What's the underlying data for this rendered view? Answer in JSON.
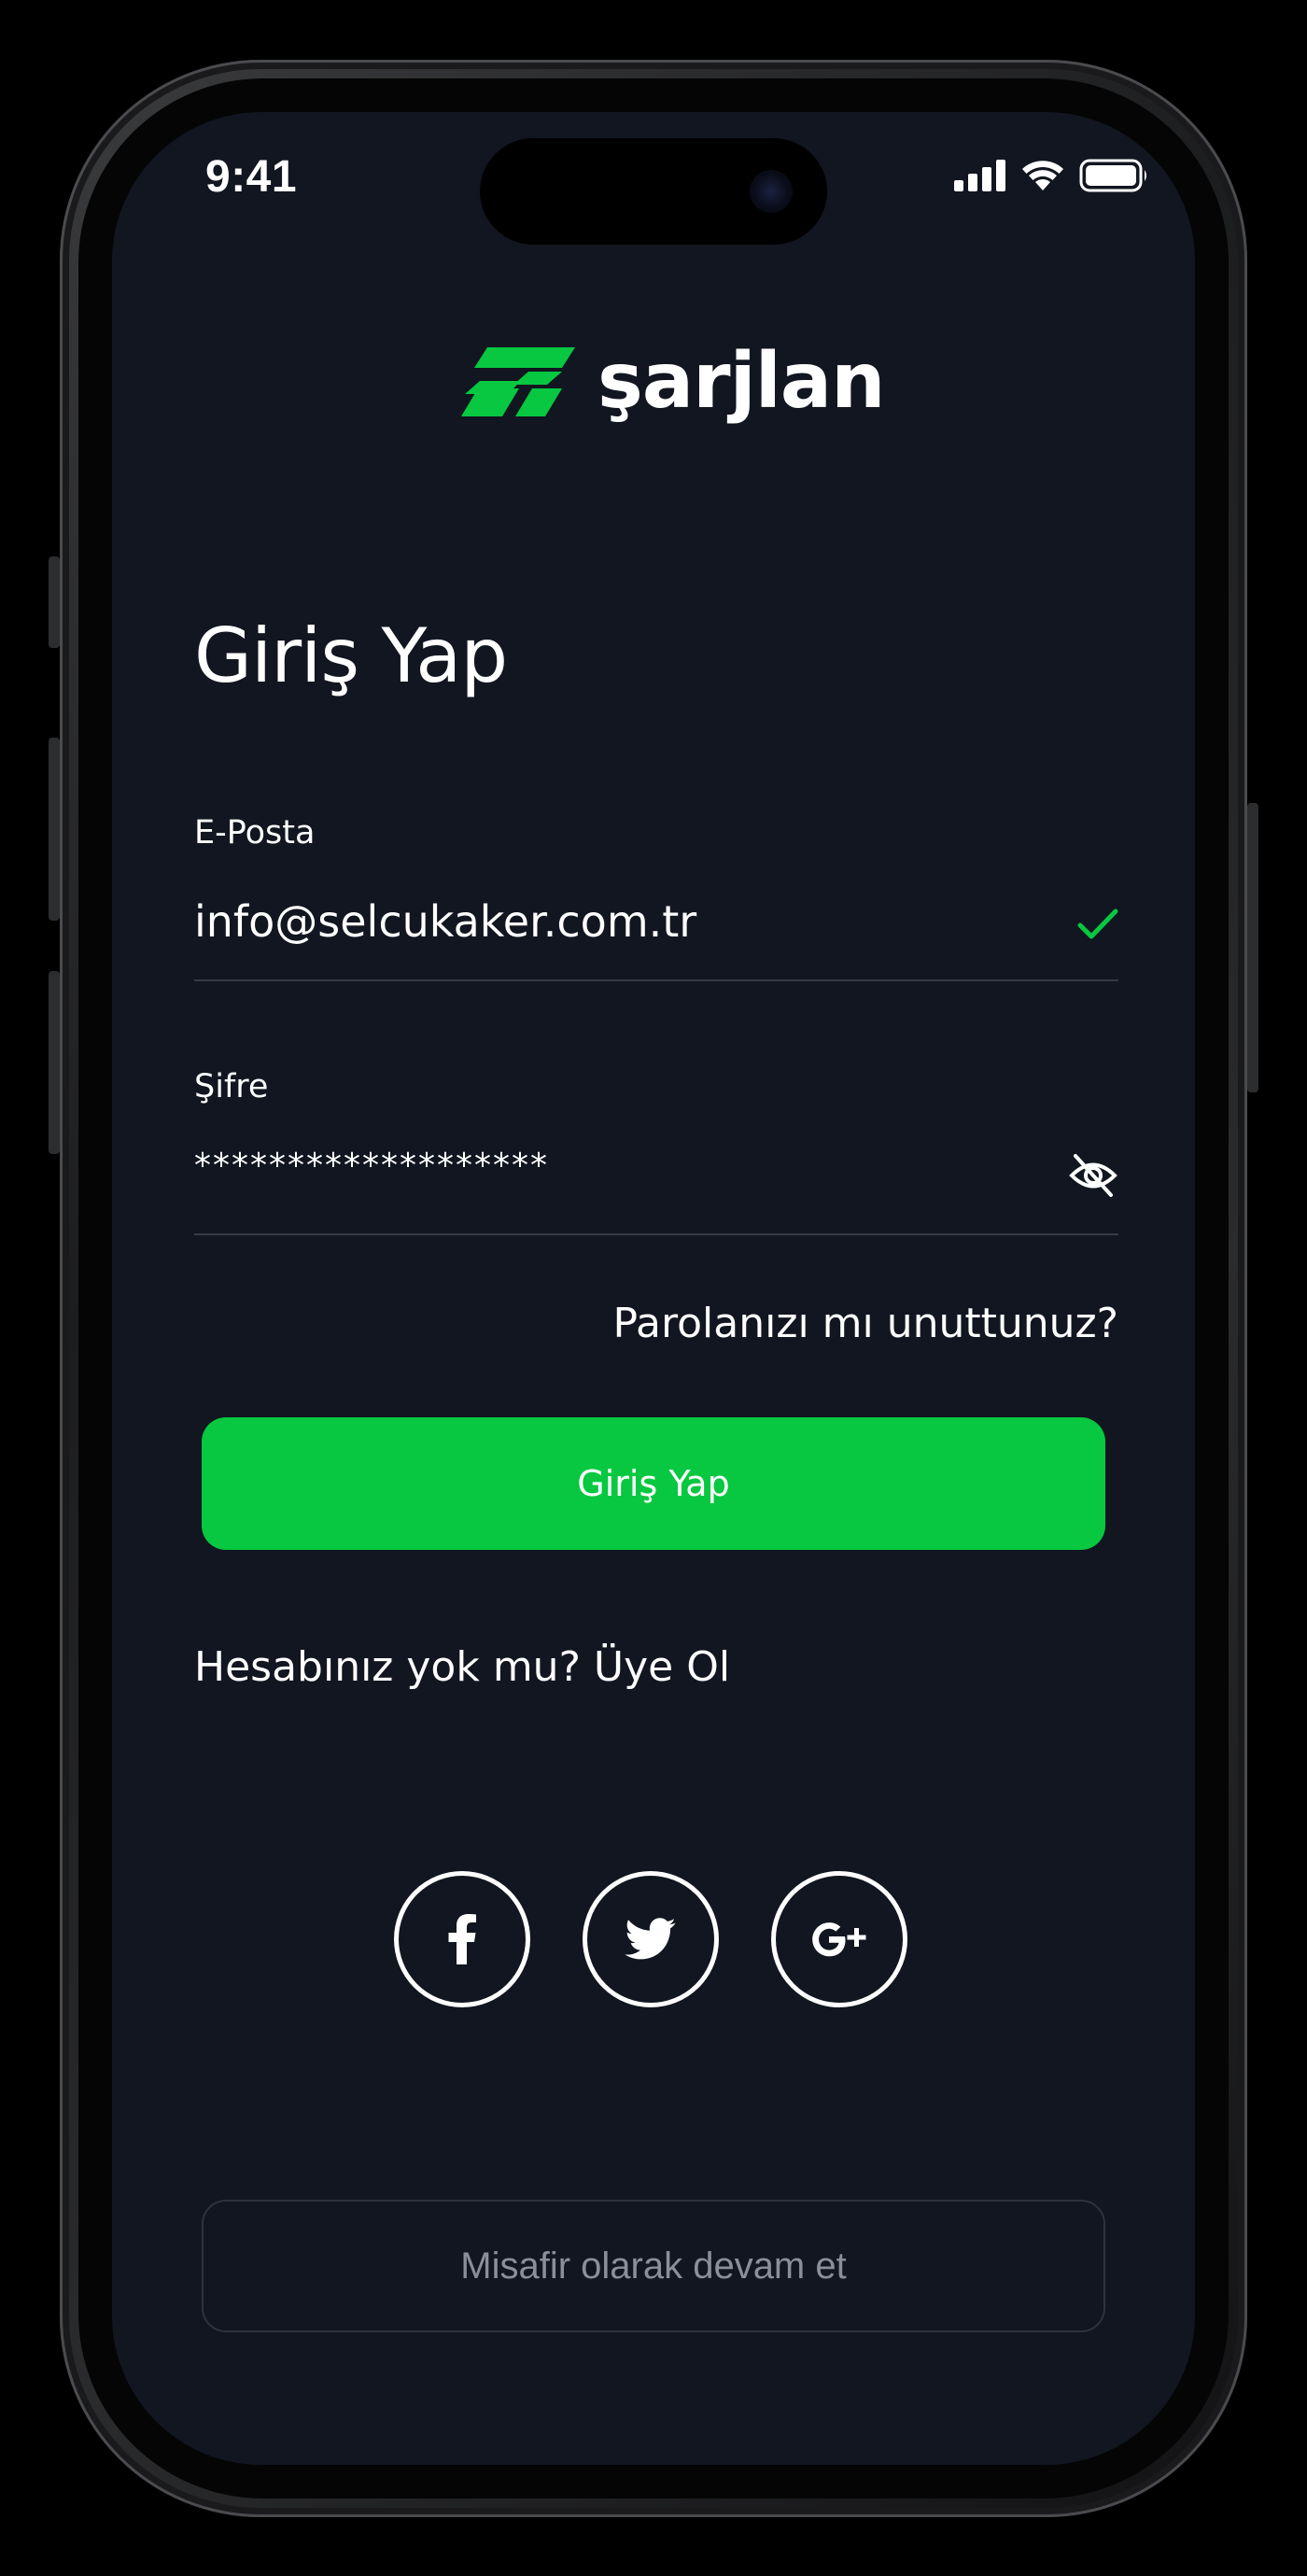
{
  "status_bar": {
    "time": "9:41"
  },
  "brand": {
    "name": "şarjlan",
    "accent_color": "#07C840"
  },
  "login": {
    "title": "Giriş Yap",
    "email_label": "E-Posta",
    "email_value": "info@selcukaker.com.tr",
    "password_label": "Şifre",
    "password_value": "*******************",
    "forgot_link": "Parolanızı mı unuttunuz?",
    "submit_label": "Giriş Yap",
    "register_link": "Hesabınız yok mu? Üye Ol",
    "guest_label": "Misafir olarak devam et"
  },
  "social_buttons": [
    {
      "icon": "facebook-icon"
    },
    {
      "icon": "twitter-icon"
    },
    {
      "icon": "google-plus-icon"
    }
  ]
}
